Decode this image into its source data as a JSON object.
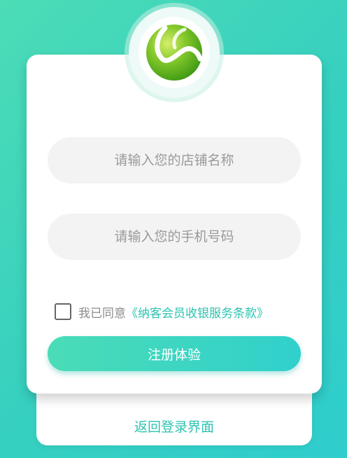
{
  "form": {
    "store_name_placeholder": "请输入您的店铺名称",
    "phone_placeholder": "请输入您的手机号码"
  },
  "agreement": {
    "prefix": "我已同意",
    "link_text": "《纳客会员收银服务条款》",
    "checked": false
  },
  "actions": {
    "register_label": "注册体验",
    "back_to_login_label": "返回登录界面"
  },
  "colors": {
    "accent": "#2cc3b1",
    "background_start": "#4cdcb6",
    "background_end": "#2fcdcd",
    "logo": "#7dc02a"
  },
  "icons": {
    "logo": "tennis-ball-logo-icon",
    "checkbox": "checkbox-unchecked-icon"
  }
}
